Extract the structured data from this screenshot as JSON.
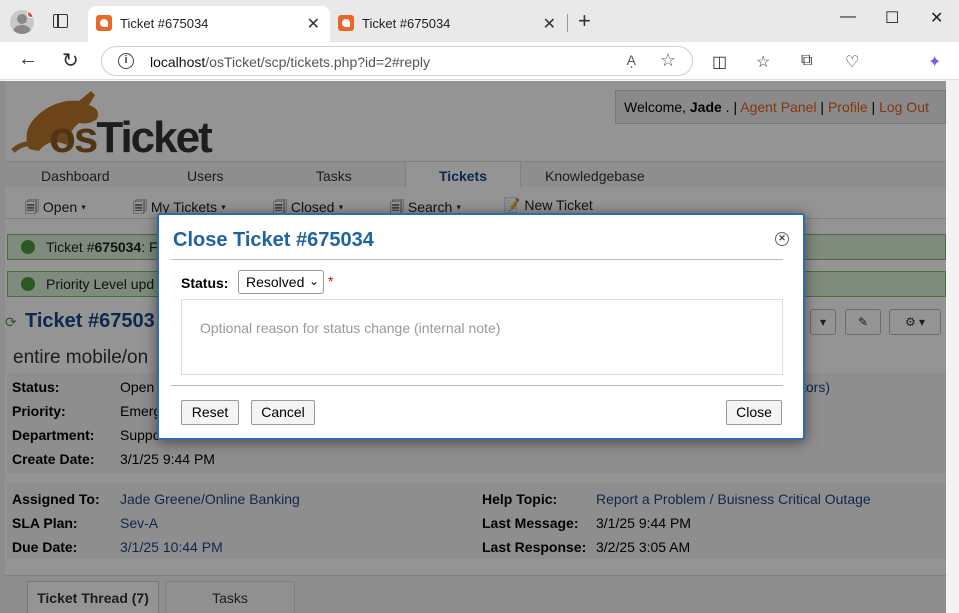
{
  "browser": {
    "tabs": [
      {
        "title": "Ticket #675034"
      },
      {
        "title": "Ticket #675034"
      }
    ],
    "url_host": "localhost",
    "url_path": "/osTicket/scp/tickets.php?id=2#reply",
    "read_aloud": "Aͅ",
    "new_tab_label": "+",
    "minimize": "—",
    "maximize": "☐",
    "close": "✕"
  },
  "header": {
    "logo_text_o": "os",
    "logo_text_rest": "Ticket",
    "welcome_prefix": "Welcome, ",
    "user_name": "Jade",
    "welcome_sep": " . | ",
    "agent_panel": "Agent Panel",
    "sep1": " | ",
    "profile": "Profile",
    "sep2": " | ",
    "logout": "Log Out"
  },
  "nav": {
    "tabs": [
      "Dashboard",
      "Users",
      "Tasks",
      "Tickets",
      "Knowledgebase"
    ],
    "sub": [
      "Open ▾",
      "My Tickets ▾",
      "Closed ▾",
      "Search ▾",
      "New Ticket"
    ]
  },
  "messages": [
    {
      "prefix": "Ticket #",
      "number": "675034",
      "rest": ": F"
    },
    {
      "text": "Priority Level upd"
    }
  ],
  "ticket": {
    "title": "Ticket #67503",
    "subject": "entire mobile/on",
    "fields_left": [
      {
        "label": "Status:",
        "value": "Open"
      },
      {
        "label": "Priority:",
        "value": "Emerg"
      },
      {
        "label": "Department:",
        "value": "Suppo"
      },
      {
        "label": "Create Date:",
        "value": "3/1/25 9:44 PM"
      }
    ],
    "right_partial": "tors)",
    "fields_assign": [
      {
        "label": "Assigned To:",
        "value": "Jade Greene/Online Banking"
      },
      {
        "label": "SLA Plan:",
        "value": "Sev-A"
      },
      {
        "label": "Due Date:",
        "value": "3/1/25 10:44 PM"
      }
    ],
    "fields_topic": [
      {
        "label": "Help Topic:",
        "value": "Report a Problem / Buisness Critical Outage"
      },
      {
        "label": "Last Message:",
        "value": "3/1/25 9:44 PM"
      },
      {
        "label": "Last Response:",
        "value": "3/2/25 3:05 AM"
      }
    ]
  },
  "thread_tabs": [
    "Ticket Thread (7)",
    "Tasks"
  ],
  "modal": {
    "title": "Close Ticket #675034",
    "close_icon": "✕",
    "status_label": "Status:",
    "status_value": "Resolved",
    "required_mark": "*",
    "note_placeholder": "Optional reason for status change (internal note)",
    "reset": "Reset",
    "cancel": "Cancel",
    "close": "Close"
  },
  "colors": {
    "brand_orange": "#e65c1b",
    "link_blue": "#19478a",
    "modal_blue": "#1f63a5",
    "success_green": "#4c9a3d"
  }
}
